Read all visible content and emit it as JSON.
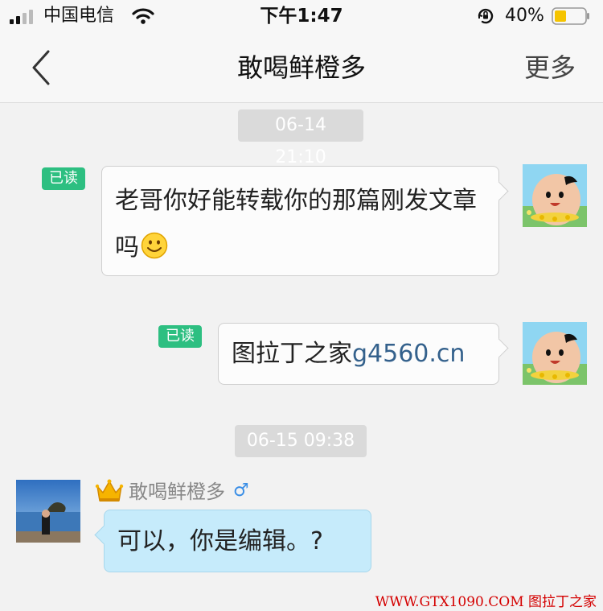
{
  "status_bar": {
    "carrier": "中国电信",
    "time": "下午1:47",
    "battery_percent": "40%",
    "battery_level": 0.4,
    "icons": [
      "signal-icon",
      "wifi-icon",
      "rotation-lock-icon",
      "battery-icon"
    ]
  },
  "nav": {
    "title": "敢喝鲜橙多",
    "more_label": "更多",
    "back_icon": "chevron-left-icon"
  },
  "chat": {
    "timestamps": [
      "06-14 21:10",
      "06-15 09:38"
    ],
    "messages": [
      {
        "direction": "outgoing",
        "read_label": "已读",
        "text": "老哥你好能转载你的那篇刚发文章吗",
        "emoji": "smiling-face-icon"
      },
      {
        "direction": "outgoing",
        "read_label": "已读",
        "text": "图拉丁之家",
        "link_text": "g4560.cn"
      },
      {
        "direction": "incoming",
        "sender": "敢喝鲜橙多",
        "sender_badge": "crown-icon",
        "gender_symbol": "♂",
        "text": "可以，你是编辑。?"
      }
    ]
  },
  "colors": {
    "read_badge": "#2dbf81",
    "incoming_bubble": "#c6ebfb",
    "link": "#34618c",
    "watermark": "#d40000"
  },
  "watermark": "WWW.GTX1090.COM 图拉丁之家"
}
